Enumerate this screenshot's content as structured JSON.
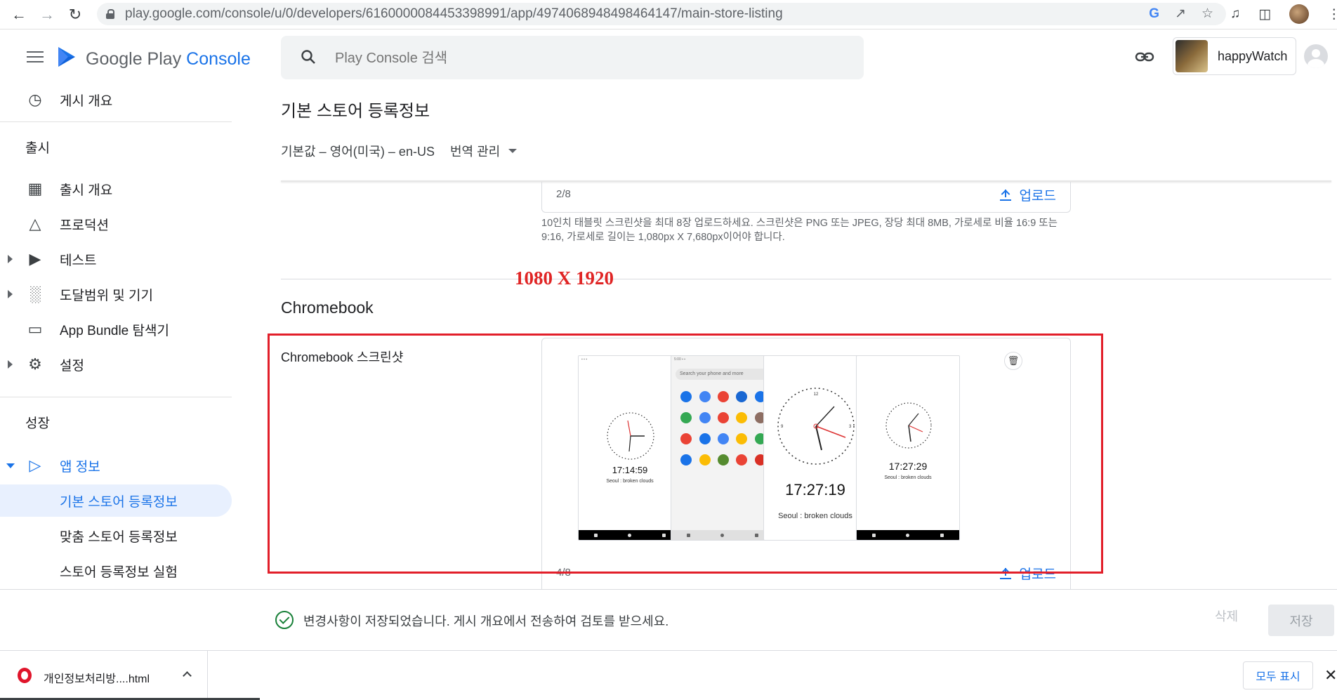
{
  "browser": {
    "url": "play.google.com/console/u/0/developers/6160000084453398991/app/4974068948498464147/main-store-listing"
  },
  "header": {
    "brand_google_play": "Google Play",
    "brand_console": "Console",
    "search_placeholder": "Play Console 검색",
    "account_name": "happyWatch"
  },
  "sidebar": {
    "top_item": "게시 개요",
    "section_release": "출시",
    "release_items": [
      "출시 개요",
      "프로덕션",
      "테스트",
      "도달범위 및 기기",
      "App Bundle 탐색기",
      "설정"
    ],
    "section_growth": "성장",
    "app_info": "앱 정보",
    "sub_items": [
      "기본 스토어 등록정보",
      "맞춤 스토어 등록정보",
      "스토어 등록정보 실험"
    ]
  },
  "main": {
    "page_title": "기본 스토어 등록정보",
    "locale": "기본값 – 영어(미국) – en-US",
    "translate_label": "번역 관리",
    "tablet": {
      "count": "2/8",
      "upload_label": "업로드",
      "help_text": "10인치 태블릿 스크린샷을 최대 8장 업로드하세요. 스크린샷은 PNG 또는 JPEG, 장당 최대 8MB, 가로세로 비율 16:9 또는 9:16, 가로세로 길이는 1,080px X 7,680px이어야 합니다."
    },
    "annotation": "1080 X 1920",
    "chromebook": {
      "section_title": "Chromebook",
      "field_label": "Chromebook 스크린샷",
      "count": "4/8",
      "upload_label": "업로드",
      "screenshots": [
        {
          "time": "17:14:59",
          "location": "Seoul : broken clouds"
        },
        {
          "search": "Search your phone and more"
        },
        {
          "time": "17:27:19",
          "location": "Seoul : broken clouds"
        },
        {
          "time": "17:27:29",
          "location": "Seoul : broken clouds"
        }
      ]
    }
  },
  "action_bar": {
    "message": "변경사항이 저장되었습니다. 게시 개요에서 전송하여 검토를 받으세요.",
    "delete_label": "삭제",
    "save_label": "저장"
  },
  "download_shelf": {
    "file_name": "개인정보처리방....html",
    "show_all_label": "모두 표시"
  },
  "colors": {
    "accent": "#1a73e8",
    "highlight": "#e21f2a",
    "success": "#188038"
  }
}
